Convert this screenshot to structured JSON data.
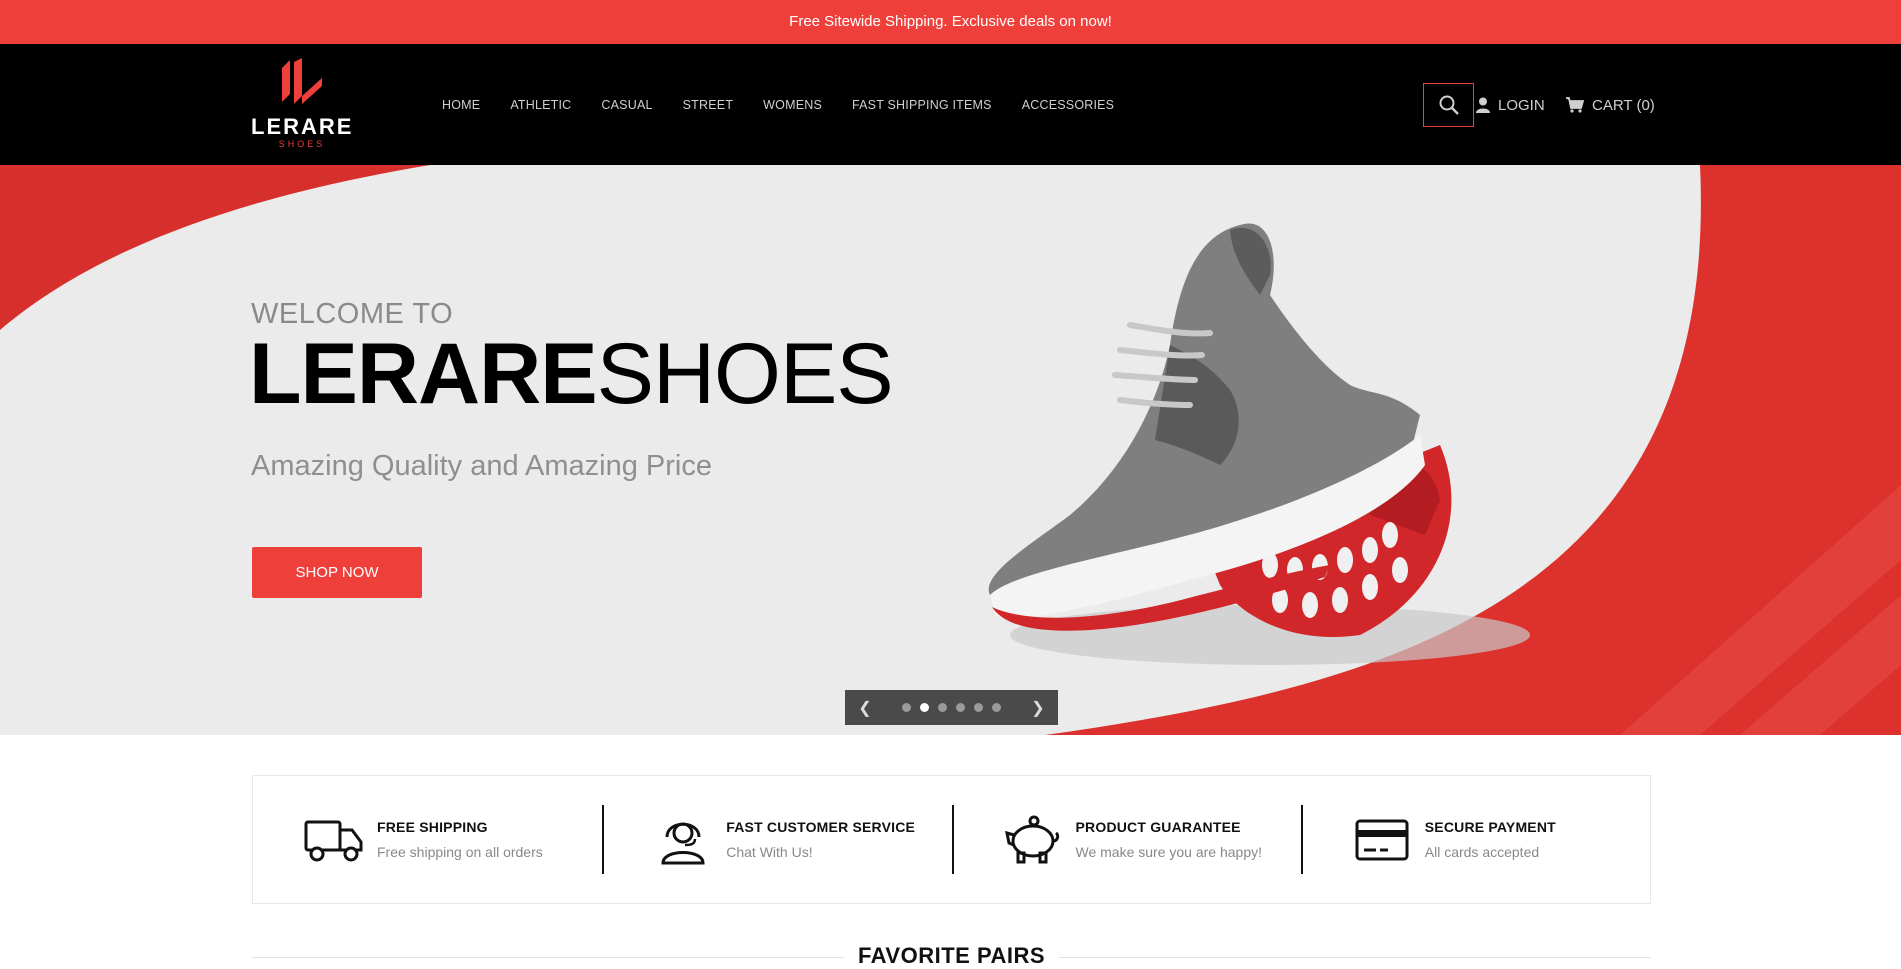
{
  "announcement": "Free Sitewide Shipping. Exclusive deals on now!",
  "logo": {
    "brand": "LERARE",
    "sub": "SHOES"
  },
  "nav": [
    "HOME",
    "ATHLETIC",
    "CASUAL",
    "STREET",
    "WOMENS",
    "FAST SHIPPING ITEMS",
    "ACCESSORIES"
  ],
  "header": {
    "login": "LOGIN",
    "cart": "CART (0)",
    "search_icon": "search-icon",
    "user_icon": "user-icon",
    "cart_icon": "cart-icon"
  },
  "hero": {
    "welcome": "WELCOME TO",
    "title_bold": "LERARE",
    "title_light": "SHOES",
    "tagline": "Amazing Quality and Amazing Price",
    "cta": "SHOP NOW",
    "slides": 6,
    "active_slide": 2
  },
  "features": [
    {
      "icon": "truck-icon",
      "title": "FREE SHIPPING",
      "desc": "Free shipping on all orders"
    },
    {
      "icon": "support-icon",
      "title": "FAST CUSTOMER SERVICE",
      "desc": "Chat With Us!"
    },
    {
      "icon": "piggy-bank-icon",
      "title": "PRODUCT GUARANTEE",
      "desc": "We make sure you are happy!"
    },
    {
      "icon": "credit-card-icon",
      "title": "SECURE PAYMENT",
      "desc": "All cards accepted"
    }
  ],
  "section_title": "FAVORITE PAIRS",
  "colors": {
    "accent": "#ef3f3a",
    "header_bg": "#000000",
    "hero_bg": "#ebebeb"
  }
}
